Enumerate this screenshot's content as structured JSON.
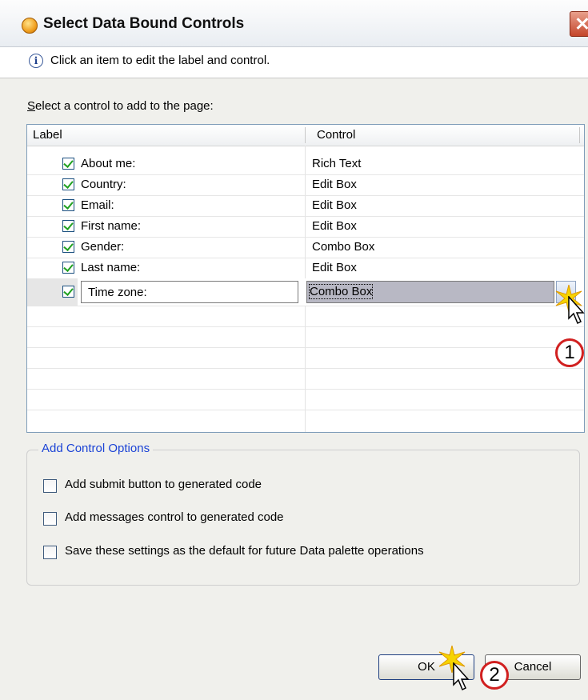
{
  "window": {
    "title": "Select Data Bound Controls"
  },
  "info": {
    "message": "Click an item to edit the label and control."
  },
  "table": {
    "prompt_prefix": "S",
    "prompt_rest": "elect a control to add to the page:",
    "columns": [
      "Label",
      "Control"
    ],
    "rows": [
      {
        "label": "About me:",
        "control": "Rich Text",
        "checked": true
      },
      {
        "label": "Country:",
        "control": "Edit Box",
        "checked": true
      },
      {
        "label": "Email:",
        "control": "Edit Box",
        "checked": true
      },
      {
        "label": "First name:",
        "control": "Edit Box",
        "checked": true
      },
      {
        "label": "Gender:",
        "control": "Combo Box",
        "checked": true
      },
      {
        "label": "Last name:",
        "control": "Edit Box",
        "checked": true
      },
      {
        "label": "Time zone:",
        "control": "Combo Box",
        "checked": true
      }
    ]
  },
  "options": {
    "group_title": "Add Control Options",
    "items": [
      {
        "label": "Add submit button to generated code",
        "checked": false
      },
      {
        "label": "Add messages control to generated code",
        "checked": false
      },
      {
        "label": "Save these settings as the default for future Data palette operations",
        "checked": false
      }
    ]
  },
  "buttons": {
    "ok": "OK",
    "cancel": "Cancel"
  },
  "callouts": [
    "1",
    "2"
  ],
  "colors": {
    "accent_blue": "#1b43d6",
    "callout_red": "#d12020",
    "check_green": "#21a121"
  }
}
